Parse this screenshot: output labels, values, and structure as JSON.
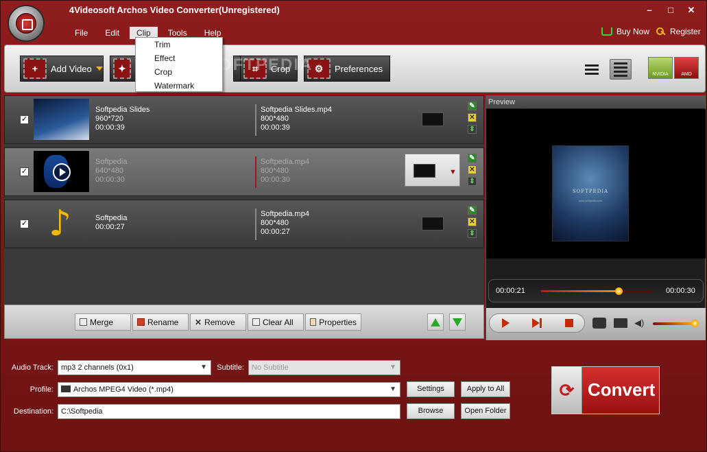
{
  "app": {
    "title": "4Videosoft Archos Video Converter(Unregistered)"
  },
  "window_controls": {
    "minimize": "–",
    "restore": "□",
    "close": "✕"
  },
  "menu": {
    "items": [
      "File",
      "Edit",
      "Clip",
      "Tools",
      "Help"
    ],
    "active": "Clip",
    "clip_submenu": [
      "Trim",
      "Effect",
      "Crop",
      "Watermark"
    ]
  },
  "top_links": {
    "buy_now": "Buy Now",
    "register": "Register"
  },
  "toolbar": {
    "add_video": "Add Video",
    "crop": "Crop",
    "preferences": "Preferences",
    "watermark_text": "SOFTPEDIA"
  },
  "badges": [
    "NVIDIA",
    "AMD"
  ],
  "files": [
    {
      "name": "Softpedia Slides",
      "resolution": "960*720",
      "duration": "00:00:39",
      "out_name": "Softpedia Slides.mp4",
      "out_resolution": "800*480",
      "out_duration": "00:00:39",
      "checked": "✓"
    },
    {
      "name": "Softpedia",
      "resolution": "640*480",
      "duration": "00:00:30",
      "out_name": "Softpedia.mp4",
      "out_resolution": "800*480",
      "out_duration": "00:00:30",
      "checked": "✓"
    },
    {
      "name": "Softpedia",
      "duration": "00:00:27",
      "out_name": "Softpedia.mp4",
      "out_resolution": "800*480",
      "out_duration": "00:00:27",
      "checked": "✓"
    }
  ],
  "list_tools": {
    "merge": "Merge",
    "rename": "Rename",
    "remove": "Remove",
    "clear_all": "Clear All",
    "properties": "Properties"
  },
  "preview": {
    "header": "Preview",
    "frame_text": "SOFTPEDIA",
    "frame_subtext": "www.softpedia.com",
    "current_time": "00:00:21",
    "total_time": "00:00:30",
    "progress": 0.7,
    "volume": 1.0
  },
  "settings": {
    "audio_track_label": "Audio Track:",
    "audio_track_value": "mp3 2 channels (0x1)",
    "subtitle_label": "Subtitle:",
    "subtitle_value": "No Subtitle",
    "profile_label": "Profile:",
    "profile_value": "Archos MPEG4 Video (*.mp4)",
    "destination_label": "Destination:",
    "destination_value": "C:\\Softpedia",
    "settings_btn": "Settings",
    "apply_all_btn": "Apply to All",
    "browse_btn": "Browse",
    "open_folder_btn": "Open Folder",
    "convert_btn": "Convert"
  },
  "colors": {
    "frame": "#8e1d1d",
    "accent": "#c41a1a",
    "progress": "#ff8a00"
  }
}
